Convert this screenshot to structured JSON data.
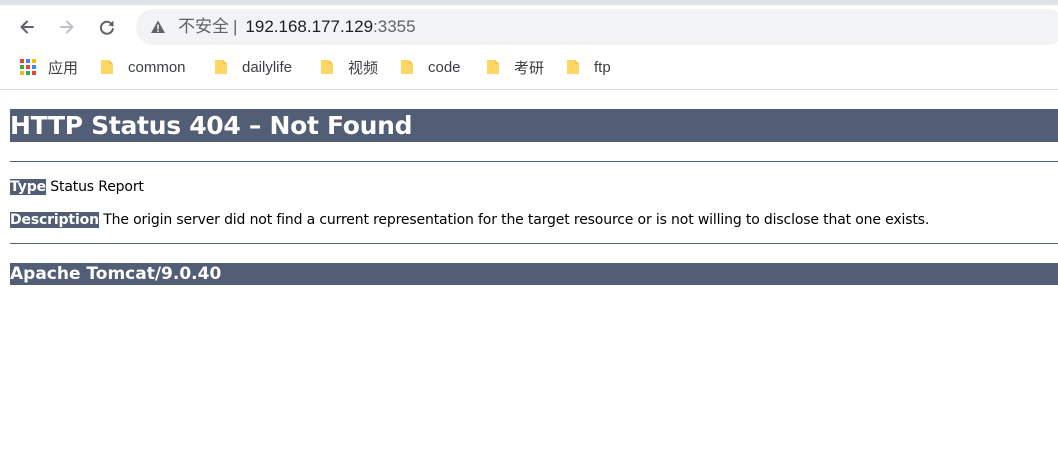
{
  "browser": {
    "address_bar": {
      "security_label": "不安全",
      "separator": "|",
      "host": "192.168.177.129",
      "port": ":3355"
    },
    "bookmarks": [
      {
        "label": "应用",
        "icon": "apps-grid-icon"
      },
      {
        "label": "common",
        "icon": "folder-icon"
      },
      {
        "label": "dailylife",
        "icon": "folder-icon"
      },
      {
        "label": "视频",
        "icon": "folder-icon"
      },
      {
        "label": "code",
        "icon": "folder-icon"
      },
      {
        "label": "考研",
        "icon": "folder-icon"
      },
      {
        "label": "ftp",
        "icon": "folder-icon"
      }
    ]
  },
  "page": {
    "title": "HTTP Status 404 – Not Found",
    "type_label": "Type",
    "type_value": " Status Report",
    "description_label": "Description",
    "description_value": " The origin server did not find a current representation for the target resource or is not willing to disclose that one exists.",
    "server_info": "Apache Tomcat/9.0.40"
  },
  "colors": {
    "tomcat_header": "#525d76",
    "folder": "#fdd663",
    "omnibox_bg": "#f1f3f4"
  }
}
